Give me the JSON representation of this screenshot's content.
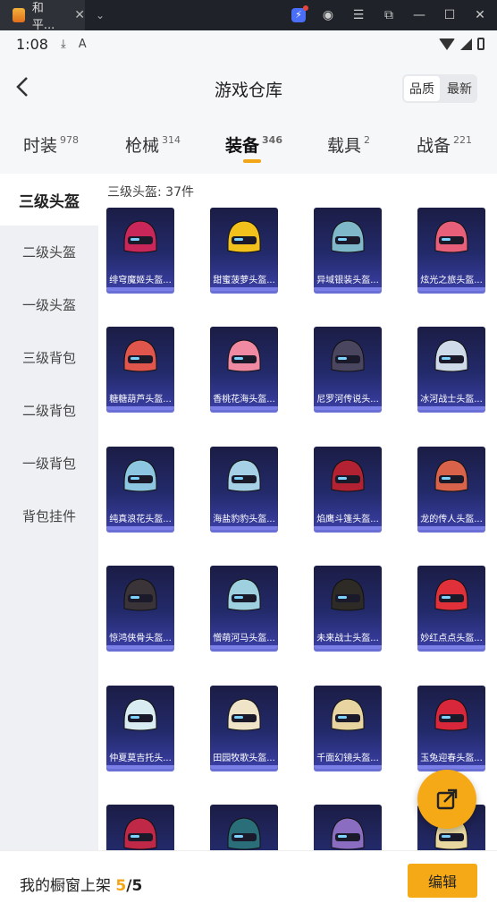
{
  "browser": {
    "tab_title": "和平...",
    "tab_close": "✕",
    "chevron": "⌄"
  },
  "status": {
    "time": "1:08"
  },
  "header": {
    "title": "游戏仓库",
    "sort_quality": "品质",
    "sort_newest": "最新"
  },
  "categories": [
    {
      "label": "时装",
      "count": "978"
    },
    {
      "label": "枪械",
      "count": "314"
    },
    {
      "label": "装备",
      "count": "346"
    },
    {
      "label": "载具",
      "count": "2"
    },
    {
      "label": "战备",
      "count": "221"
    }
  ],
  "sidebar": {
    "items": [
      "三级头盔",
      "二级头盔",
      "一级头盔",
      "三级背包",
      "二级背包",
      "一级背包",
      "背包挂件"
    ]
  },
  "grid": {
    "heading": "三级头盔: 37件",
    "items": [
      {
        "label": "绯穹魔姬头盔...",
        "color": "#c9265a"
      },
      {
        "label": "甜蜜菠萝头盔...",
        "color": "#f2c11c"
      },
      {
        "label": "异域银装头盔...",
        "color": "#7fb8c8"
      },
      {
        "label": "炫光之旅头盔...",
        "color": "#e85f7a"
      },
      {
        "label": "糖糖葫芦头盔...",
        "color": "#e0564c"
      },
      {
        "label": "香桃花海头盔...",
        "color": "#f08aa2"
      },
      {
        "label": "尼罗河传说头...",
        "color": "#4a4660"
      },
      {
        "label": "冰河战士头盔...",
        "color": "#d0dbea"
      },
      {
        "label": "纯真浪花头盔...",
        "color": "#8cc6e0"
      },
      {
        "label": "海盐豹豹头盔...",
        "color": "#a6d0e6"
      },
      {
        "label": "焰鹰斗篷头盔...",
        "color": "#b22233"
      },
      {
        "label": "龙的传人头盔...",
        "color": "#d9624a"
      },
      {
        "label": "惊鸿侠骨头盔...",
        "color": "#3a3438"
      },
      {
        "label": "憎萌河马头盔...",
        "color": "#9fd0e0"
      },
      {
        "label": "未来战士头盔...",
        "color": "#2e2a26"
      },
      {
        "label": "妙红点点头盔...",
        "color": "#e0303a"
      },
      {
        "label": "仲夏莫吉托头...",
        "color": "#d9ecf2"
      },
      {
        "label": "田园牧歌头盔...",
        "color": "#f0e4c8"
      },
      {
        "label": "千面幻镜头盔...",
        "color": "#e8d4a0"
      },
      {
        "label": "玉兔迎春头盔...",
        "color": "#d8263a"
      },
      {
        "label": "",
        "color": "#c02848"
      },
      {
        "label": "",
        "color": "#2a6e7a"
      },
      {
        "label": "",
        "color": "#8a6cc0"
      },
      {
        "label": "",
        "color": "#e8d8a0"
      }
    ]
  },
  "footer": {
    "label": "我的橱窗上架",
    "count_current": "5",
    "count_total": "/5",
    "edit": "编辑"
  },
  "colors": {
    "accent": "#f6a916",
    "card_bg": "#232a6a"
  }
}
